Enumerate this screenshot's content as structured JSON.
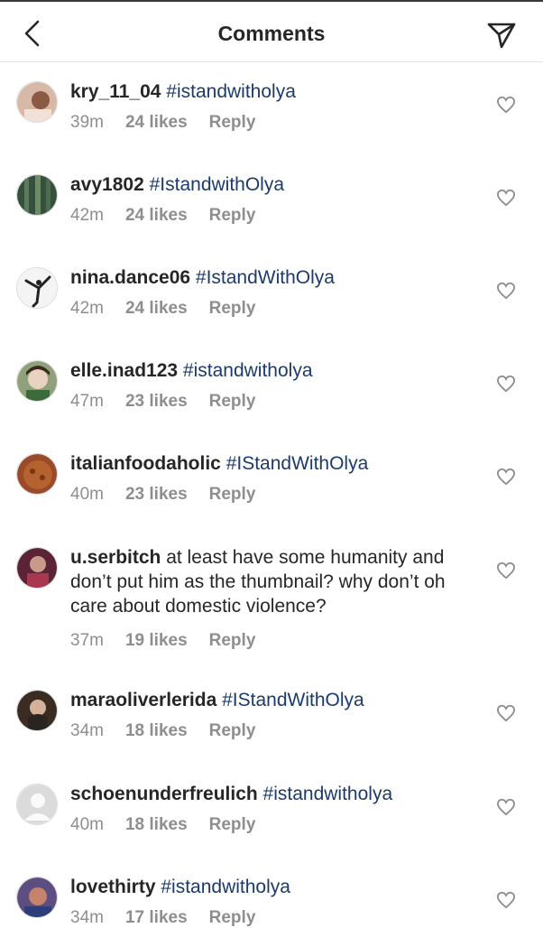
{
  "header": {
    "title": "Comments",
    "back_icon": "chevron-left-icon",
    "send_icon": "send-paper-plane-icon"
  },
  "colors": {
    "text": "#262626",
    "muted": "#8e8e8e",
    "hashtag": "#1c3a6b",
    "divider": "#e2e2e2"
  },
  "comments": [
    {
      "username": "kry_11_04",
      "text": "#istandwitholya",
      "time": "39m",
      "likes": "24 likes",
      "reply": "Reply",
      "avatar": "#c9a592"
    },
    {
      "username": "avy1802",
      "text": "#IstandwithOlya",
      "time": "42m",
      "likes": "24 likes",
      "reply": "Reply",
      "avatar": "#3e5a43"
    },
    {
      "username": "nina.dance06",
      "text": "#IstandWithOlya",
      "time": "42m",
      "likes": "24 likes",
      "reply": "Reply",
      "avatar": "#e8e8e8"
    },
    {
      "username": "elle.inad123",
      "text": "#istandwitholya",
      "time": "47m",
      "likes": "23 likes",
      "reply": "Reply",
      "avatar": "#7d8f6a"
    },
    {
      "username": "italianfoodaholic",
      "text": "#IStandWithOlya",
      "time": "40m",
      "likes": "23 likes",
      "reply": "Reply",
      "avatar": "#a0502d"
    },
    {
      "username": "u.serbitch",
      "text": "at least have some humanity and don’t put him as the thumbnail? why don’t oh care about domestic violence?",
      "time": "37m",
      "likes": "19 likes",
      "reply": "Reply",
      "avatar": "#6b2a3c"
    },
    {
      "username": "maraoliverlerida",
      "text": "#IStandWithOlya",
      "time": "34m",
      "likes": "18 likes",
      "reply": "Reply",
      "avatar": "#4a3a2c"
    },
    {
      "username": "schoenunderfreulich",
      "text": "#istandwitholya",
      "time": "40m",
      "likes": "18 likes",
      "reply": "Reply",
      "avatar": "#dcdcdc"
    },
    {
      "username": "lovethirty",
      "text": "#istandwitholya",
      "time": "34m",
      "likes": "17 likes",
      "reply": "Reply",
      "avatar": "#6a5a8c"
    }
  ]
}
